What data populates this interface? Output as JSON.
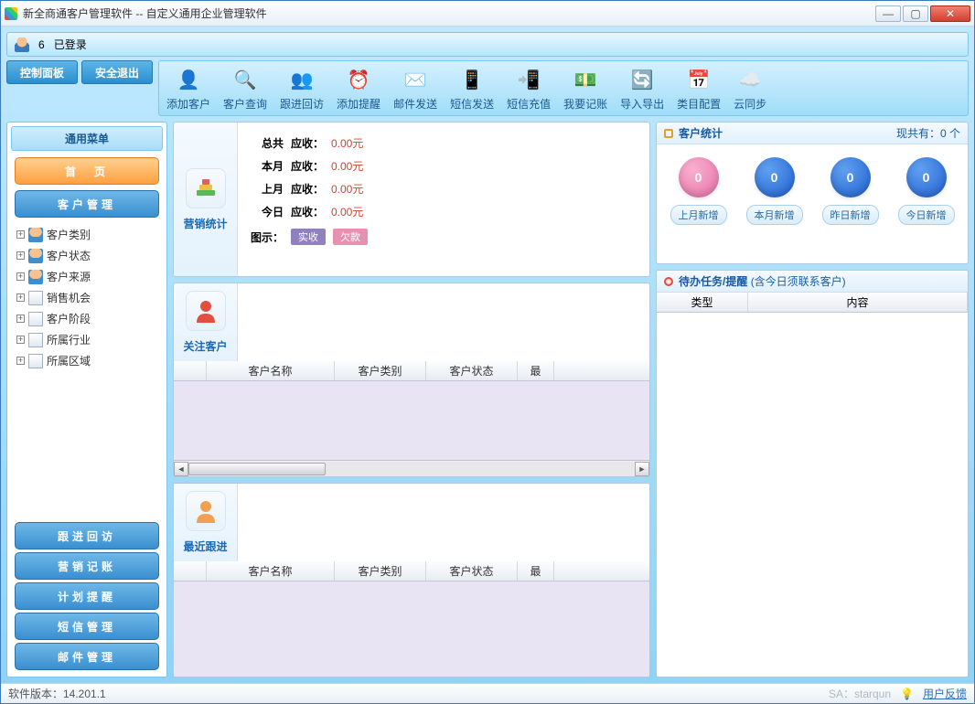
{
  "window": {
    "title": "新全商通客户管理软件 -- 自定义通用企业管理软件"
  },
  "header": {
    "login_count": "6",
    "login_status": "已登录"
  },
  "nav_buttons": {
    "panel": "控制面板",
    "exit": "安全退出"
  },
  "toolbar": [
    {
      "name": "add-customer",
      "label": "添加客户",
      "icon": "👤"
    },
    {
      "name": "customer-search",
      "label": "客户查询",
      "icon": "🔍"
    },
    {
      "name": "followup",
      "label": "跟进回访",
      "icon": "👥"
    },
    {
      "name": "add-reminder",
      "label": "添加提醒",
      "icon": "⏰"
    },
    {
      "name": "email-send",
      "label": "邮件发送",
      "icon": "✉️"
    },
    {
      "name": "sms-send",
      "label": "短信发送",
      "icon": "📱"
    },
    {
      "name": "sms-recharge",
      "label": "短信充值",
      "icon": "📲"
    },
    {
      "name": "bookkeeping",
      "label": "我要记账",
      "icon": "💵"
    },
    {
      "name": "import-export",
      "label": "导入导出",
      "icon": "🔄"
    },
    {
      "name": "category-config",
      "label": "类目配置",
      "icon": "📅"
    },
    {
      "name": "cloud-sync",
      "label": "云同步",
      "icon": "☁️"
    }
  ],
  "sidebar": {
    "title": "通用菜单",
    "home": "首　页",
    "customer_mgmt": "客户管理",
    "tree": [
      {
        "label": "客户类别",
        "icon": "people"
      },
      {
        "label": "客户状态",
        "icon": "people"
      },
      {
        "label": "客户来源",
        "icon": "people"
      },
      {
        "label": "销售机会",
        "icon": "doc"
      },
      {
        "label": "客户阶段",
        "icon": "doc"
      },
      {
        "label": "所属行业",
        "icon": "doc"
      },
      {
        "label": "所属区域",
        "icon": "doc"
      }
    ],
    "bottom": [
      "跟进回访",
      "营销记账",
      "计划提醒",
      "短信管理",
      "邮件管理"
    ]
  },
  "sales_stats": {
    "side_label": "营销统计",
    "rows": [
      {
        "period": "总共",
        "type": "应收：",
        "value": "0.00元"
      },
      {
        "period": "本月",
        "type": "应收：",
        "value": "0.00元"
      },
      {
        "period": "上月",
        "type": "应收：",
        "value": "0.00元"
      },
      {
        "period": "今日",
        "type": "应收：",
        "value": "0.00元"
      }
    ],
    "legend_label": "图示：",
    "legend_paid": "实收",
    "legend_owe": "欠款"
  },
  "focus_customers": {
    "side_label": "关注客户",
    "columns": [
      "",
      "客户名称",
      "客户类别",
      "客户状态",
      "最"
    ]
  },
  "recent_followup": {
    "side_label": "最近跟进",
    "columns": [
      "",
      "客户名称",
      "客户类别",
      "客户状态",
      "最"
    ]
  },
  "customer_stats": {
    "title": "客户统计",
    "total_label": "现共有：0 个",
    "circles": [
      {
        "value": "0",
        "label": "上月新增",
        "color": "pink"
      },
      {
        "value": "0",
        "label": "本月新增",
        "color": "blue"
      },
      {
        "value": "0",
        "label": "昨日新增",
        "color": "blue"
      },
      {
        "value": "0",
        "label": "今日新增",
        "color": "blue"
      }
    ]
  },
  "tasks": {
    "title": "待办任务/提醒",
    "subtitle": "(含今日须联系客户)",
    "columns": [
      "类型",
      "内容"
    ]
  },
  "statusbar": {
    "version": "软件版本：14.201.1",
    "sa": "SA：starqun",
    "feedback": "用户反馈"
  }
}
